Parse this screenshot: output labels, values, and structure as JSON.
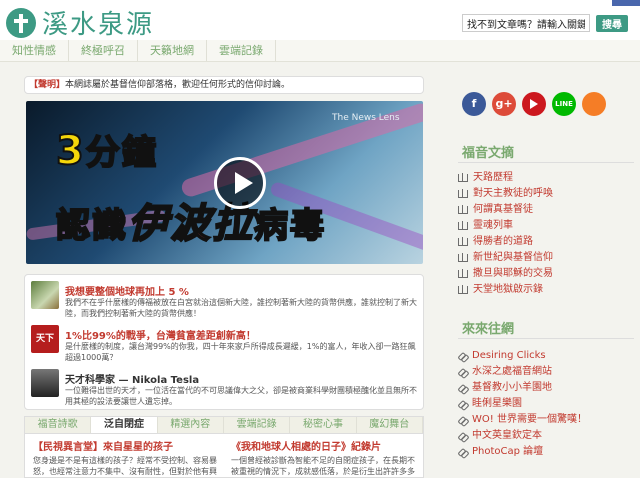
{
  "header": {
    "site_name": "溪水泉源",
    "search_placeholder": "找不到文章嗎？請輸入關鍵字",
    "search_button": "搜尋"
  },
  "nav": [
    "知性情感",
    "終極呼召",
    "天籟地網",
    "雲端記錄"
  ],
  "notice": {
    "tag": "【聲明】",
    "text": "本網誌屬於基督信仰部落格，歡迎任何形式的信仰討論。"
  },
  "video": {
    "source": "The News Lens",
    "line1_num": "3",
    "line1_text": "分鐘",
    "line2_a": "認識",
    "line2_red": "伊波拉",
    "line2_b": "病毒"
  },
  "posts": [
    {
      "title": "我想要整個地球再加上 5 %",
      "desc": "我們不在乎什麼樣的傳福被放在白宮就治這個新大陸，誰控制著新大陸的貨幣供應，誰就控制了新大陸，而我們控制著新大陸的貨幣供應！"
    },
    {
      "title": "1%比99%的戰爭，台灣貧富差距創新高！",
      "thumb_text": "天下",
      "desc": "是什麼樣的制度，讓台灣99%的你我，四十年來家戶所得成長遲緩，1%的富人，年收入卻一路狂飆超過1000萬？"
    },
    {
      "title": "天才科學家 — Nikola Tesla",
      "desc": "一位難得出世的天才，一位活在當代的不可思議偉大之父，卻是被商業科學財團積極醜化並且無所不用其極的設法要讓世人遺忘掉。"
    }
  ],
  "tabs": [
    "福音詩歌",
    "泛自閉症",
    "精選內容",
    "雲端記錄",
    "秘密心事",
    "魔幻舞台"
  ],
  "active_tab": 1,
  "tab_panel": [
    {
      "title": "【民視異言堂】來自星星的孩子",
      "desc": "您身邊是不是有這樣的孩子？經常不受控制、容易暴怒，也經常注意力不集中、沒有耐性，但對於他有興趣的事物，卻又特別地執著？別以為這些孩子就像聽懂"
    },
    {
      "title": "《我和地球人相處的日子》紀錄片",
      "desc": "一個曾經被診斷為智能不足的自閉症孩子，在長期不被重視的情況下，成就感低落，於是衍生出許許多多的行為問題……"
    }
  ],
  "social": [
    "f",
    "g+",
    "",
    "LINE",
    ""
  ],
  "sidebar": {
    "gospel_title": "福音文摘",
    "gospel_items": [
      "天路歷程",
      "對天主教徒的呼喚",
      "何謂真基督徒",
      "靈魂列車",
      "得勝者的道路",
      "新世紀與基督信仰",
      "撒旦與耶穌的交易",
      "天堂地獄啟示錄"
    ],
    "links_title": "來來往網",
    "link_items": [
      "Desiring Clicks",
      "水深之處福音網站",
      "基督教小小羊園地",
      "眭俐星樂園",
      "WO! 世界需要一個驚嘆！",
      "中文英皇欽定本",
      "PhotoCap 論壇"
    ],
    "link_colors": [
      "#4a6d9c",
      "#c23a2f",
      "#c23a2f",
      "#c23a2f",
      "#c23a2f",
      "#c23a2f",
      "#4a6d9c"
    ]
  }
}
